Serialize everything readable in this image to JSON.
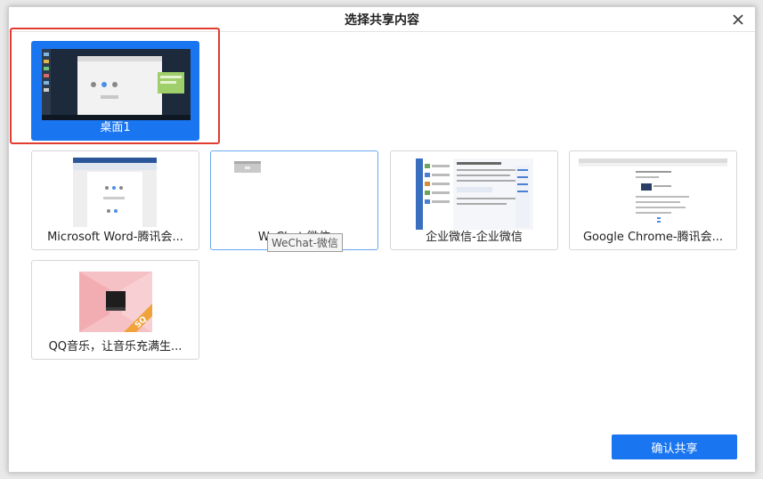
{
  "dialog": {
    "title": "选择共享内容",
    "close_icon": "close-icon"
  },
  "sources": [
    {
      "label": "桌面1",
      "selected": true
    },
    {
      "label": "Microsoft Word-腾讯会...",
      "selected": false
    },
    {
      "label": "WeChat-微信",
      "selected": false
    },
    {
      "label": "企业微信-企业微信",
      "selected": false
    },
    {
      "label": "Google Chrome-腾讯会...",
      "selected": false
    },
    {
      "label": "QQ音乐，让音乐充满生...",
      "selected": false
    }
  ],
  "tooltip": "WeChat-微信",
  "confirm_label": "确认共享",
  "colors": {
    "accent": "#1a75f0",
    "highlight_outline": "#e23b2f"
  }
}
